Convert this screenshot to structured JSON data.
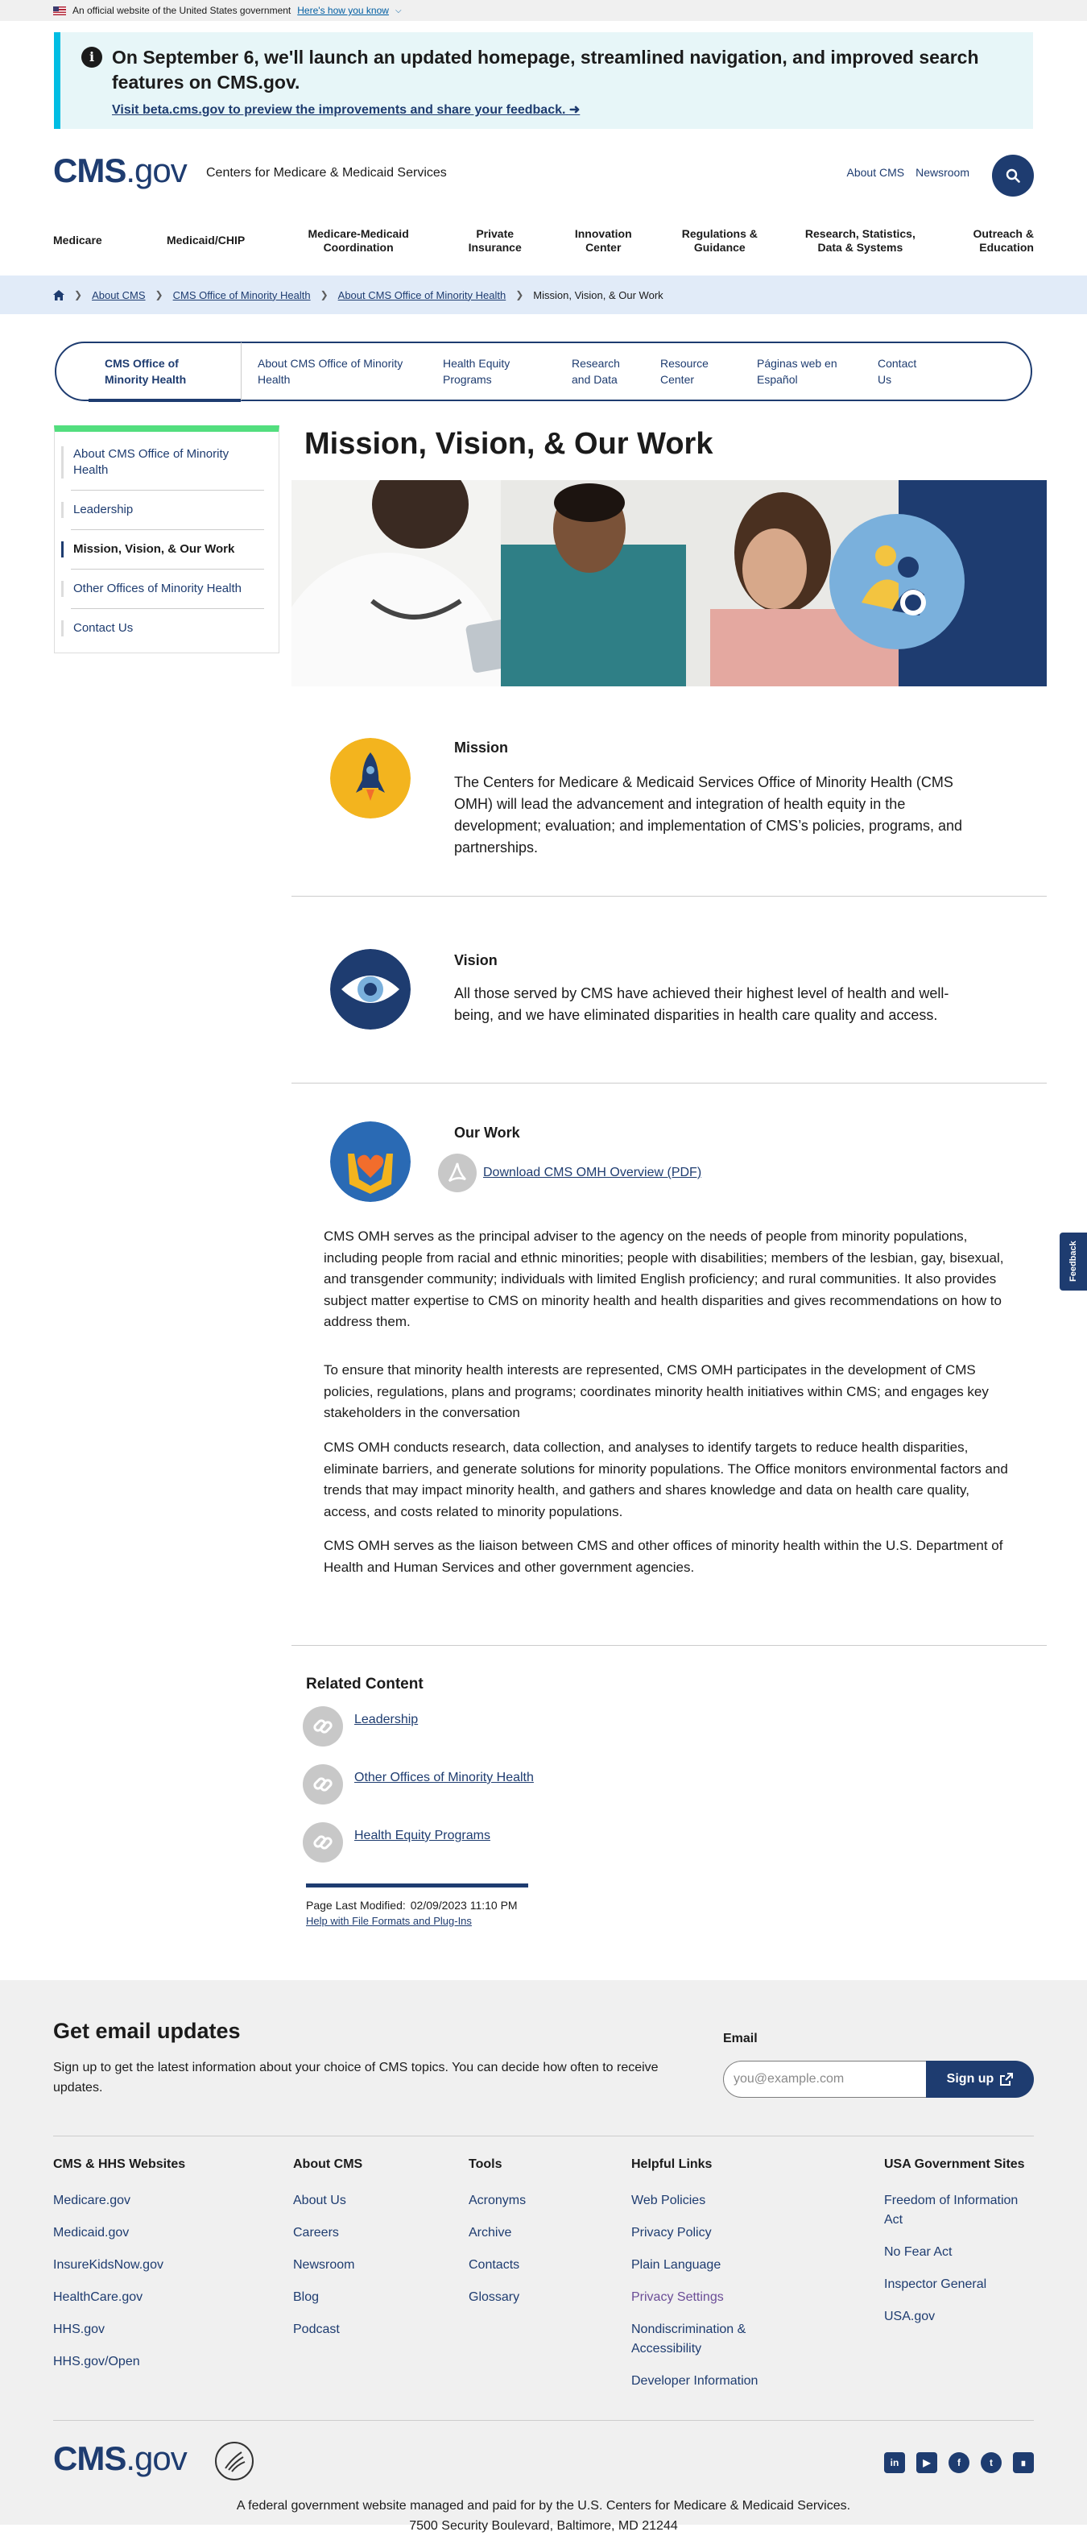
{
  "gov_banner": {
    "text": "An official website of the United States government",
    "link": "Here's how you know"
  },
  "alert": {
    "heading": "On September 6, we'll launch an updated homepage, streamlined navigation, and improved search features on CMS.gov.",
    "link": "Visit beta.cms.gov to preview the improvements and share your feedback."
  },
  "header": {
    "logo_bold": "CMS",
    "logo_thin": ".gov",
    "site_name": "Centers for Medicare & Medicaid Services",
    "utility_links": [
      "About CMS",
      "Newsroom"
    ]
  },
  "main_nav": [
    "Medicare",
    "Medicaid/CHIP",
    "Medicare-Medicaid Coordination",
    "Private Insurance",
    "Innovation Center",
    "Regulations & Guidance",
    "Research, Statistics, Data & Systems",
    "Outreach & Education"
  ],
  "breadcrumb": {
    "items": [
      "About CMS",
      "CMS Office of Minority Health",
      "About CMS Office of Minority Health"
    ],
    "current": "Mission, Vision, & Our Work"
  },
  "section_nav": [
    "CMS Office of Minority Health",
    "About CMS Office of Minority Health",
    "Health Equity Programs",
    "Research and Data",
    "Resource Center",
    "Páginas web en Español",
    "Contact Us"
  ],
  "side_nav": [
    "About CMS Office of Minority Health",
    "Leadership",
    "Mission, Vision, & Our Work",
    "Other Offices of Minority Health",
    "Contact Us"
  ],
  "page_title": "Mission, Vision, & Our Work",
  "mission": {
    "heading": "Mission",
    "text": "The Centers for Medicare & Medicaid Services Office of Minority Health (CMS OMH) will lead the advancement and integration of health equity in the development; evaluation; and implementation of CMS’s policies, programs, and partnerships."
  },
  "vision": {
    "heading": "Vision",
    "text": "All those served by CMS have achieved their highest level of health and well-being, and we have eliminated disparities in health care quality and access."
  },
  "our_work": {
    "heading": "Our Work",
    "pdf_link": "Download CMS OMH Overview (PDF)",
    "paragraphs": [
      "CMS OMH serves as the principal adviser to the agency on the needs of people from minority populations, including people from racial and ethnic minorities; people with disabilities; members of the lesbian, gay, bisexual, and transgender community; individuals with limited English proficiency; and rural communities. It also provides subject matter expertise to CMS on minority health and health disparities and gives recommendations on how to address them.",
      "To ensure that minority health interests are represented, CMS OMH participates in the development of CMS policies, regulations, plans and programs; coordinates minority health initiatives within CMS; and engages key stakeholders in the conversation",
      "CMS OMH conducts research, data collection, and analyses to identify targets to reduce health disparities, eliminate barriers, and generate solutions for minority populations. The Office monitors environmental factors and trends that may impact minority health, and gathers and shares knowledge and data on health care quality, access, and costs related to minority populations.",
      "CMS OMH serves as the liaison between CMS and other offices of minority health within the U.S. Department of Health and Human Services and other government agencies."
    ]
  },
  "related": {
    "title": "Related Content",
    "items": [
      "Leadership",
      "Other Offices of Minority Health",
      "Health Equity Programs"
    ]
  },
  "modified": {
    "label": "Page Last Modified:",
    "date": "02/09/2023 11:10 PM",
    "help": "Help with File Formats and Plug-Ins"
  },
  "feedback": "Feedback",
  "footer": {
    "email_title": "Get email updates",
    "email_text": "Sign up to get the latest information about your choice of CMS topics. You can decide how often to receive updates.",
    "email_label": "Email",
    "email_placeholder": "you@example.com",
    "signup": "Sign up",
    "columns": [
      {
        "title": "CMS & HHS Websites",
        "links": [
          "Medicare.gov",
          "Medicaid.gov",
          "InsureKidsNow.gov",
          "HealthCare.gov",
          "HHS.gov",
          "HHS.gov/Open"
        ]
      },
      {
        "title": "About CMS",
        "links": [
          "About Us",
          "Careers",
          "Newsroom",
          "Blog",
          "Podcast"
        ]
      },
      {
        "title": "Tools",
        "links": [
          "Acronyms",
          "Archive",
          "Contacts",
          "Glossary"
        ]
      },
      {
        "title": "Helpful Links",
        "links": [
          "Web Policies",
          "Privacy Policy",
          "Plain Language",
          "Privacy Settings",
          "Nondiscrimination & Accessibility",
          "Developer Information"
        ]
      },
      {
        "title": "USA Government Sites",
        "links": [
          "Freedom of Information Act",
          "No Fear Act",
          "Inspector General",
          "USA.gov"
        ]
      }
    ],
    "logo_bold": "CMS",
    "logo_thin": ".gov",
    "bottom_line1": "A federal government website managed and paid for by the U.S. Centers for Medicare & Medicaid Services.",
    "bottom_line2": "7500 Security Boulevard, Baltimore, MD 21244"
  },
  "colors": {
    "brand": "#1e3c70",
    "accent": "#52de7e",
    "alert_bg": "#e7f6f8",
    "alert_border": "#00bde3"
  },
  "icons": [
    "us-flag-icon",
    "info-icon",
    "arrow-right-icon",
    "search-icon",
    "home-icon",
    "rocket-icon",
    "eye-icon",
    "hands-heart-icon",
    "pdf-icon",
    "link-icon",
    "external-link-icon",
    "hhs-seal-icon",
    "linkedin-icon",
    "youtube-icon",
    "facebook-icon",
    "twitter-icon",
    "rss-icon"
  ]
}
